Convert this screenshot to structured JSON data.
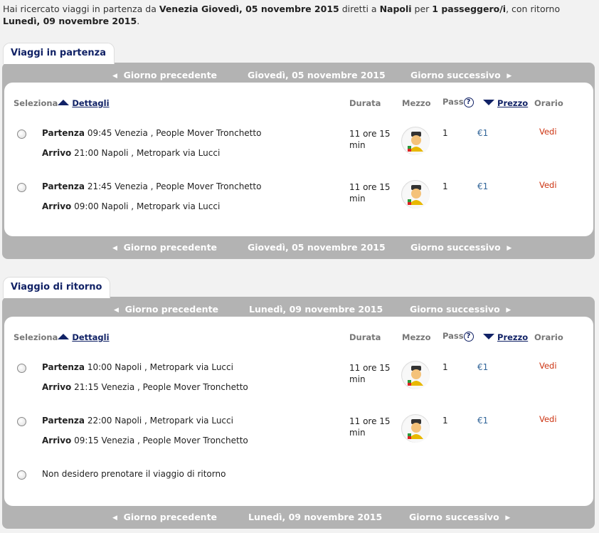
{
  "intro": {
    "t1": "Hai ricercato viaggi in partenza da ",
    "b1": "Venezia Giovedì, 05 novembre 2015",
    "t2": " diretti a ",
    "b2": "Napoli",
    "t3": " per ",
    "b3": "1 passeggero/i",
    "t4": ", con ritorno ",
    "b4": "Lunedì, 09 novembre 2015",
    "t5": "."
  },
  "outbound": {
    "tab": "Viaggi in partenza",
    "prev": "Giorno precedente",
    "date": "Giovedì, 05 novembre 2015",
    "next": "Giorno successivo",
    "rows": [
      {
        "dep_label": "Partenza",
        "dep": "09:45 Venezia , People Mover Tronchetto",
        "arr_label": "Arrivo",
        "arr": "21:00 Napoli , Metropark via Lucci",
        "dur": "11 ore 15 min",
        "pass": "1",
        "price": "€1",
        "orario": "Vedi"
      },
      {
        "dep_label": "Partenza",
        "dep": "21:45 Venezia , People Mover Tronchetto",
        "arr_label": "Arrivo",
        "arr": "09:00 Napoli , Metropark via Lucci",
        "dur": "11 ore 15 min",
        "pass": "1",
        "price": "€1",
        "orario": "Vedi"
      }
    ]
  },
  "inbound": {
    "tab": "Viaggio di ritorno",
    "prev": "Giorno precedente",
    "date": "Lunedì, 09 novembre 2015",
    "next": "Giorno successivo",
    "rows": [
      {
        "dep_label": "Partenza",
        "dep": "10:00 Napoli , Metropark via Lucci",
        "arr_label": "Arrivo",
        "arr": "21:15 Venezia , People Mover Tronchetto",
        "dur": "11 ore 15 min",
        "pass": "1",
        "price": "€1",
        "orario": "Vedi"
      },
      {
        "dep_label": "Partenza",
        "dep": "22:00 Napoli , Metropark via Lucci",
        "arr_label": "Arrivo",
        "arr": "09:15 Venezia , People Mover Tronchetto",
        "dur": "11 ore 15 min",
        "pass": "1",
        "price": "€1",
        "orario": "Vedi"
      }
    ],
    "no_return": "Non desidero prenotare il viaggio di ritorno"
  },
  "headers": {
    "seleziona": "Seleziona",
    "dettagli": "Dettagli",
    "durata": "Durata",
    "mezzo": "Mezzo",
    "pass": "Pass",
    "help": "?",
    "prezzo": "Prezzo",
    "orario": "Orario"
  },
  "icons": {
    "prev": "triangle-left-icon",
    "next": "triangle-right-icon",
    "sort_up": "triangle-up-icon",
    "sort_down": "triangle-down-icon",
    "help": "question-circle-icon",
    "bus": "bus-driver-mascot-icon"
  },
  "colors": {
    "heading": "#112266",
    "price": "#336699",
    "orario": "#cc3311",
    "bar": "#b3b3b3"
  }
}
